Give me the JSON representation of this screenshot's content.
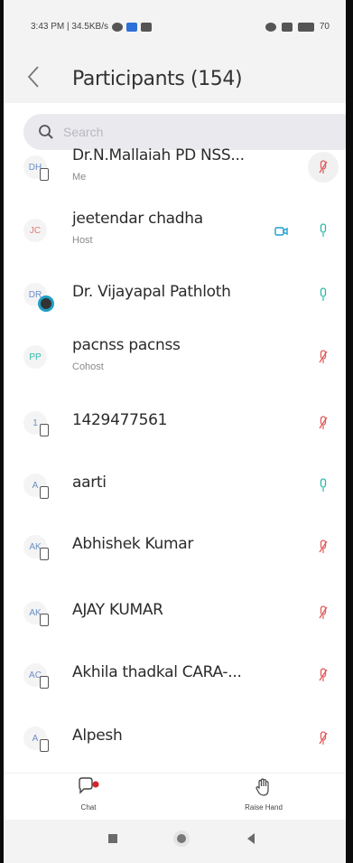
{
  "status_bar": {
    "left_text": "3:43 PM | 34.5KB/s",
    "right_text": "70"
  },
  "header": {
    "title": "Participants (154)"
  },
  "search": {
    "placeholder": "Search"
  },
  "colors": {
    "muted_mic": "#e05a5a",
    "unmuted_mic": "#2bb8a7",
    "camera": "#1e9fd0",
    "chat_dot": "#d8232a"
  },
  "participants": [
    {
      "initials": "DH",
      "name": "Dr.N.Mallaiah PD NSS...",
      "role": "Me",
      "mic": "muted",
      "camera": false,
      "badge": "phone"
    },
    {
      "initials": "JC",
      "name": "jeetendar chadha",
      "role": "Host",
      "mic": "unmuted",
      "camera": true,
      "badge": "none"
    },
    {
      "initials": "DR",
      "name": "Dr. Vijayapal Pathloth",
      "role": "",
      "mic": "unmuted",
      "camera": false,
      "badge": "ring"
    },
    {
      "initials": "PP",
      "name": "pacnss pacnss",
      "role": "Cohost",
      "mic": "muted",
      "camera": false,
      "badge": "none"
    },
    {
      "initials": "1",
      "name": "1429477561",
      "role": "",
      "mic": "muted",
      "camera": false,
      "badge": "phone"
    },
    {
      "initials": "A",
      "name": "aarti",
      "role": "",
      "mic": "unmuted",
      "camera": false,
      "badge": "phone"
    },
    {
      "initials": "AK",
      "name": "Abhishek Kumar",
      "role": "",
      "mic": "muted",
      "camera": false,
      "badge": "phone"
    },
    {
      "initials": "AK",
      "name": "AJAY KUMAR",
      "role": "",
      "mic": "muted",
      "camera": false,
      "badge": "phone"
    },
    {
      "initials": "AC",
      "name": "Akhila thadkal CARA-...",
      "role": "",
      "mic": "muted",
      "camera": false,
      "badge": "phone"
    },
    {
      "initials": "A",
      "name": "Alpesh",
      "role": "",
      "mic": "muted",
      "camera": false,
      "badge": "phone"
    }
  ],
  "bottom_bar": {
    "chat_label": "Chat",
    "raise_hand_label": "Raise Hand"
  }
}
